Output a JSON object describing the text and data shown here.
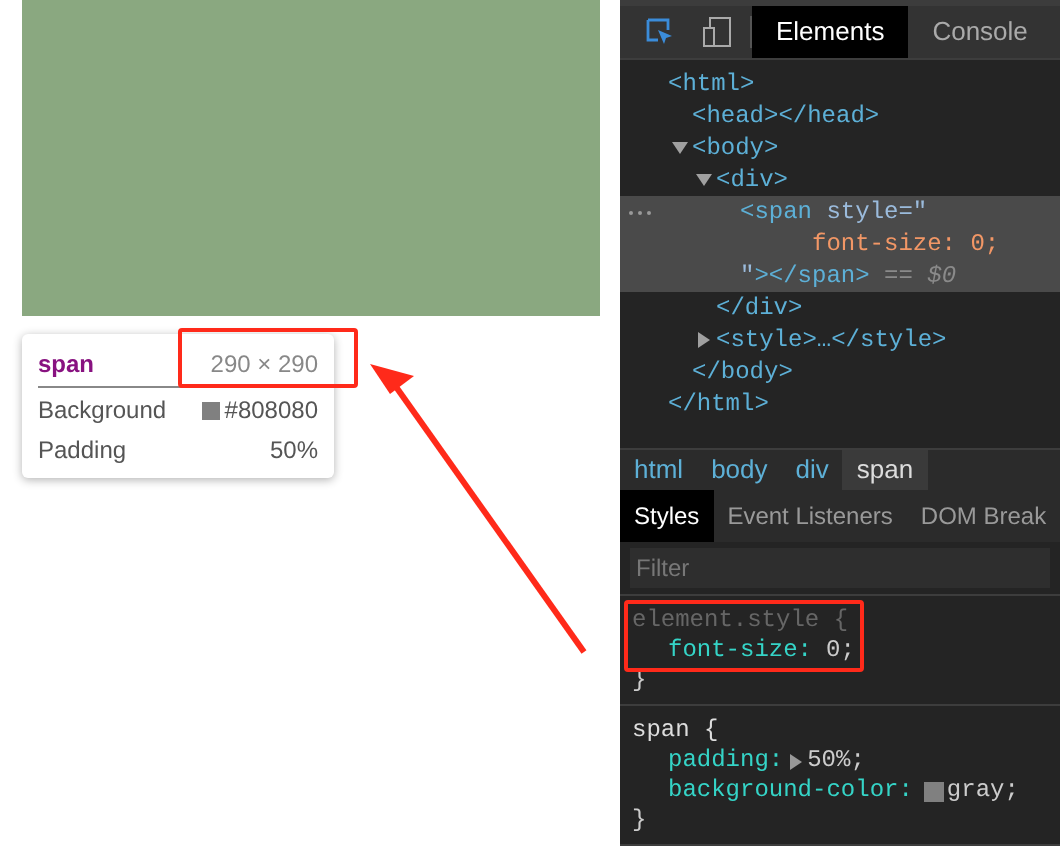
{
  "tooltip": {
    "tag": "span",
    "size": "290 × 290",
    "rows": [
      {
        "label": "Background",
        "value": "#808080",
        "kind": "color"
      },
      {
        "label": "Padding",
        "value": "50%"
      }
    ]
  },
  "devtools": {
    "tabs": [
      {
        "label": "Elements",
        "selected": true
      },
      {
        "label": "Console",
        "selected": false
      }
    ],
    "tree": [
      {
        "kind": "plain",
        "open": "<html>",
        "close": "</html>",
        "selected": false,
        "children": [
          {
            "kind": "plain",
            "open": "<head></head>",
            "selected": false
          },
          {
            "kind": "toggle",
            "expanded": true,
            "open": "<body>",
            "close": "</body>",
            "selected": false,
            "children": [
              {
                "kind": "toggle",
                "expanded": true,
                "open": "<div>",
                "close": "</div>",
                "selected": false,
                "children": [
                  {
                    "kind": "element",
                    "selected": true,
                    "lines": [
                      [
                        {
                          "kind": "tag",
                          "text": "<span "
                        },
                        {
                          "kind": "attr",
                          "text": "style=\""
                        }
                      ],
                      [
                        {
                          "kind": "value",
                          "text": "font-size: 0;"
                        }
                      ],
                      [
                        {
                          "kind": "attr",
                          "text": "\""
                        },
                        {
                          "kind": "tag",
                          "text": "></span>"
                        },
                        {
                          "kind": "marker",
                          "text": " == $0"
                        }
                      ]
                    ]
                  }
                ]
              },
              {
                "kind": "toggle",
                "expanded": false,
                "open": "<style>…</style>",
                "selected": false
              }
            ]
          }
        ]
      }
    ],
    "breadcrumbs": [
      {
        "label": "html",
        "selected": false
      },
      {
        "label": "body",
        "selected": false
      },
      {
        "label": "div",
        "selected": false
      },
      {
        "label": "span",
        "selected": true
      }
    ],
    "style_tabs": [
      {
        "label": "Styles",
        "selected": true
      },
      {
        "label": "Event Listeners",
        "selected": false
      },
      {
        "label": "DOM Break",
        "selected": false
      }
    ],
    "filter": {
      "placeholder": "Filter"
    },
    "rules": [
      {
        "selector": "element.style {",
        "declarations": [
          {
            "property": "font-size:",
            "value": "0;"
          }
        ],
        "close": "}",
        "highlighted": true
      },
      {
        "selector": "span {",
        "declarations": [
          {
            "property": "padding:",
            "value": "50%;",
            "expander": true
          },
          {
            "property": "background-color:",
            "value": "gray;",
            "kind": "color"
          }
        ],
        "close": "}",
        "highlighted": false
      }
    ]
  }
}
